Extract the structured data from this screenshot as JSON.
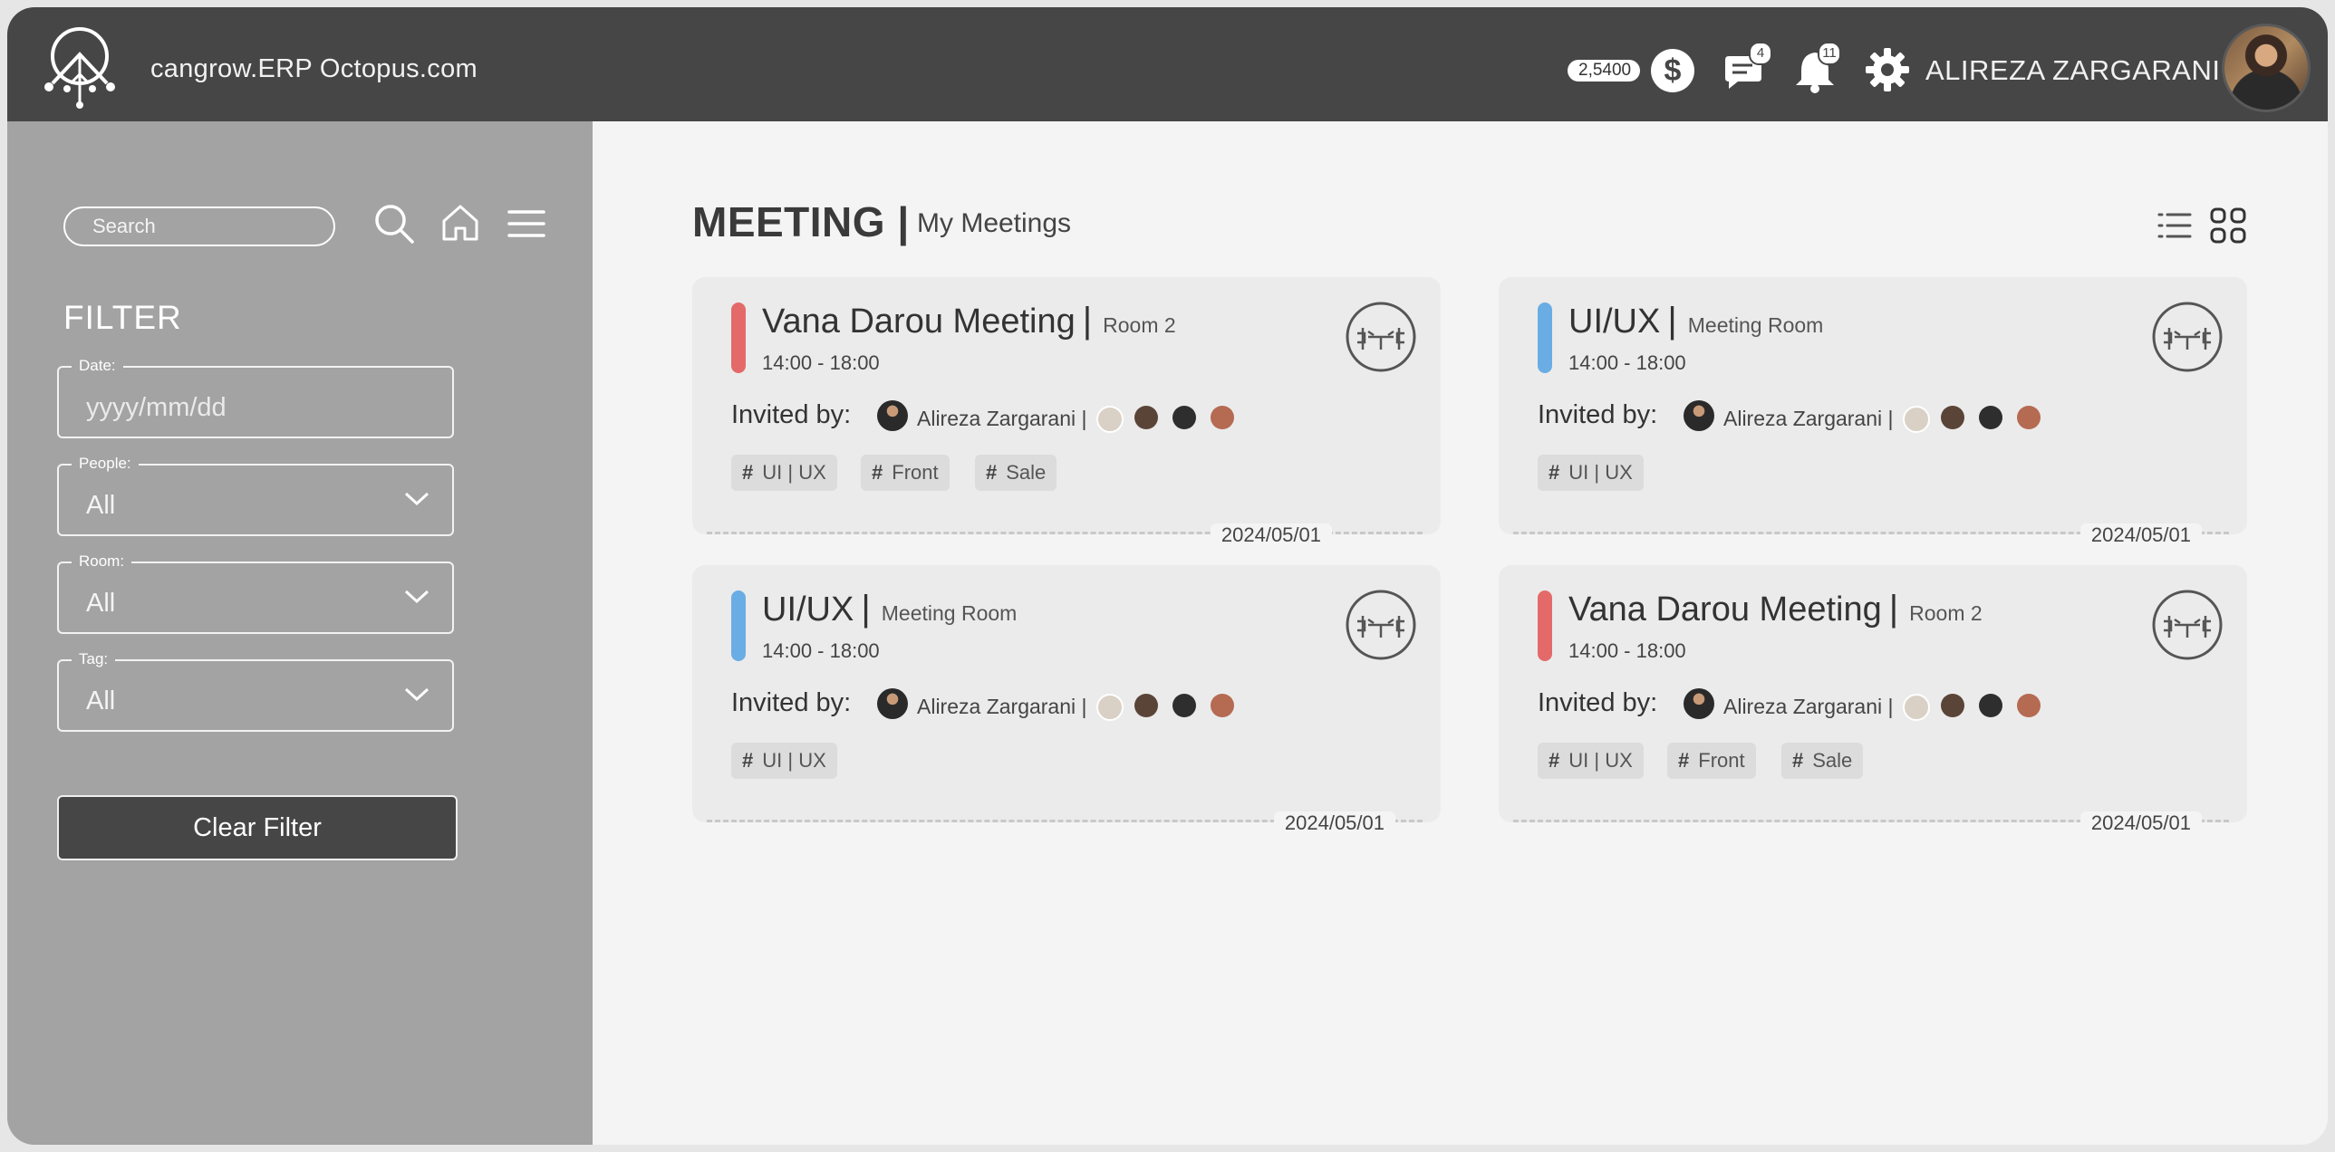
{
  "header": {
    "brand": "cangrow.ERP Octopus.com",
    "coins": "2,5400",
    "messages_count": "4",
    "notifications_count": "11",
    "user_name": "ALIREZA ZARGARANI"
  },
  "sidebar": {
    "search_placeholder": "Search",
    "filter_title": "FILTER",
    "date": {
      "label": "Date:",
      "placeholder": "yyyy/mm/dd"
    },
    "people": {
      "label": "People:",
      "value": "All"
    },
    "room": {
      "label": "Room:",
      "value": "All"
    },
    "tag": {
      "label": "Tag:",
      "value": "All"
    },
    "clear_button": "Clear Filter"
  },
  "main": {
    "title": "MEETING |",
    "subtitle": "My Meetings",
    "cards": [
      {
        "title": "Vana Darou Meeting",
        "room": "Room 2",
        "time": "14:00 - 18:00",
        "invited_label": "Invited by:",
        "inviter": "Alireza Zargarani |",
        "tags": [
          "UI | UX",
          "Front",
          "Sale"
        ],
        "date": "2024/05/01",
        "color": "#e46a6a"
      },
      {
        "title": "UI/UX",
        "room": "Meeting Room",
        "time": "14:00 - 18:00",
        "invited_label": "Invited by:",
        "inviter": "Alireza Zargarani |",
        "tags": [
          "UI | UX"
        ],
        "date": "2024/05/01",
        "color": "#6aade4"
      },
      {
        "title": "UI/UX",
        "room": "Meeting Room",
        "time": "14:00 - 18:00",
        "invited_label": "Invited by:",
        "inviter": "Alireza Zargarani |",
        "tags": [
          "UI | UX"
        ],
        "date": "2024/05/01",
        "color": "#6aade4"
      },
      {
        "title": "Vana Darou Meeting",
        "room": "Room 2",
        "time": "14:00 - 18:00",
        "invited_label": "Invited by:",
        "inviter": "Alireza Zargarani |",
        "tags": [
          "UI | UX",
          "Front",
          "Sale"
        ],
        "date": "2024/05/01",
        "color": "#e46a6a"
      }
    ]
  },
  "icons": {
    "logo": "octopus-logo-icon",
    "dollar": "dollar-coin-icon",
    "chat": "chat-icon",
    "bell": "bell-icon",
    "settings": "gear-icon",
    "search": "search-icon",
    "home": "home-icon",
    "menu": "hamburger-menu-icon",
    "list_view": "list-view-icon",
    "grid_view": "grid-view-icon",
    "meeting_room": "meeting-table-icon"
  }
}
